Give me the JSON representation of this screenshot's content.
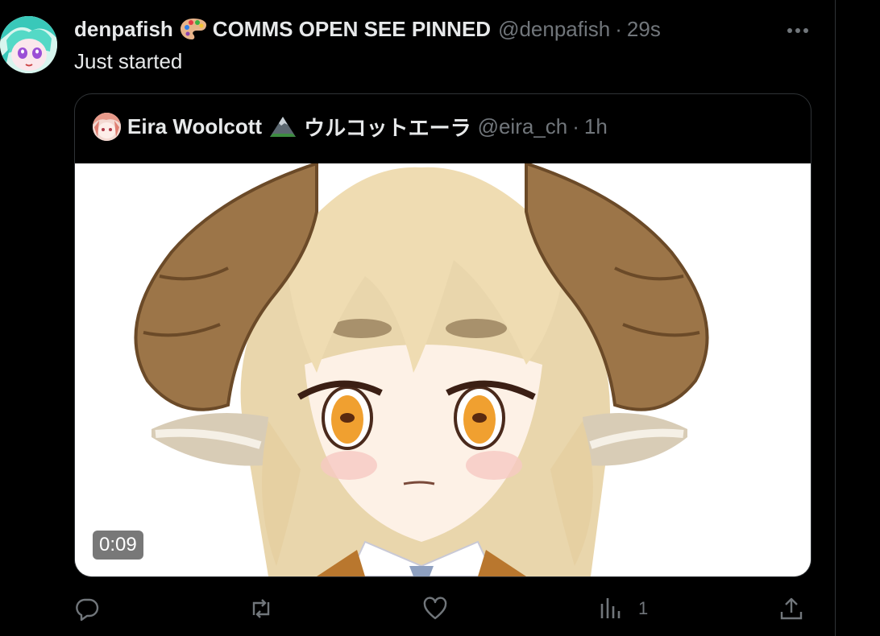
{
  "tweet": {
    "display_name": "denpafish",
    "name_emoji": "palette-emoji",
    "name_suffix": "COMMS OPEN SEE PINNED",
    "handle": "@denpafish",
    "separator": "·",
    "time": "29s",
    "text": "Just started"
  },
  "quote": {
    "display_name": "Eira Woolcott",
    "name_emoji": "mountain-emoji",
    "name_jp": "ウルコットエーラ",
    "handle": "@eira_ch",
    "separator": "·",
    "time": "1h",
    "media": {
      "type": "video",
      "duration": "0:09"
    }
  },
  "actions": {
    "reply": {
      "icon": "reply-icon"
    },
    "repost": {
      "icon": "repost-icon"
    },
    "like": {
      "icon": "heart-icon"
    },
    "views": {
      "icon": "views-icon",
      "count": "1"
    },
    "share": {
      "icon": "share-icon"
    }
  },
  "colors": {
    "background": "#000000",
    "text_primary": "#e7e9ea",
    "text_secondary": "#71767b",
    "border": "#2f3336"
  }
}
